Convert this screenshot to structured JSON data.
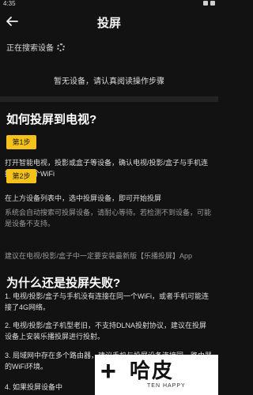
{
  "status": {
    "time": "4:35"
  },
  "header": {
    "title": "投屏"
  },
  "search": {
    "status_text": "正在搜索设备"
  },
  "devices": {
    "empty_text": "暂无设备，请认真阅读操作步骤"
  },
  "guide": {
    "heading": "如何投屏到电视?",
    "step1_label": "第1步",
    "step1_text": "打开智能电视，投影或盒子等设备，确认电视/投影/盒子与手机连接着同一个WiFi",
    "step2_label": "第2步",
    "step2_text": "在上方设备列表中，选中投屏设备，即可开始投屏",
    "note1": "系统会自动搜索可投屏设备，请耐心等待。若检测不到设备，可能是设备不支持。",
    "note2": "建议在电视/投影/盒子中一定要安装最新版【乐播投屏】App"
  },
  "faq": {
    "heading": "为什么还是投屏失败?",
    "item1": "1. 电视/投影/盒子与手机没有连接在同一个WiFi，或者手机可能连接了4G网络。",
    "item2": "2. 电视/投影/盒子机型老旧，不支持DLNA投射协议，建议在投屏设备上安装乐播投屏进行投射。",
    "item3": "3. 局域网中存在多个路由器，建议手机与投屏设备连接同一路由器的WiFi环境。",
    "item4": "4. 如果投屏设备中"
  },
  "watermark": {
    "text": "哈皮",
    "sub": "TEN HAPPY"
  }
}
